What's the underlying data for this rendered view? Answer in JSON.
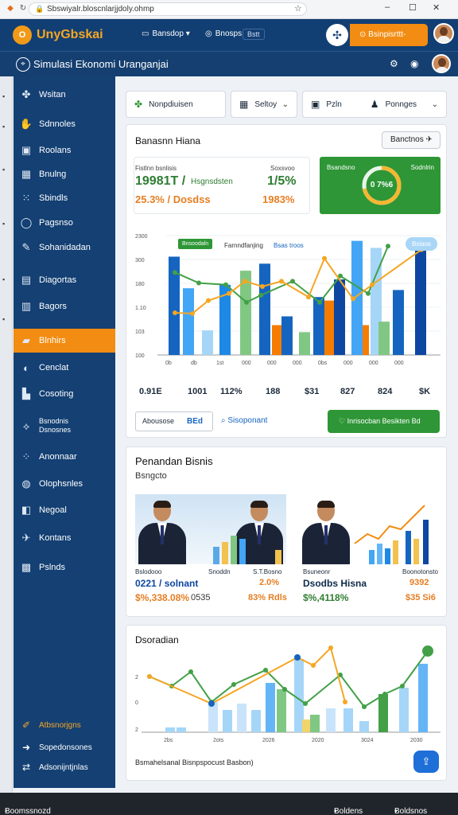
{
  "browser": {
    "address": "Sbswiyalr.bloscnlarjjdoly.ohmp",
    "window_controls": [
      "–",
      "☐",
      "✕"
    ]
  },
  "header": {
    "brand": "UnyGbskai",
    "brand_mark": "O",
    "nav": [
      {
        "icon": "display-icon",
        "label": "Bansdop"
      },
      {
        "icon": "globe-icon",
        "label": "Bnosps"
      }
    ],
    "ghost_label": "Bstt",
    "cta_label": "Bsinpisrttt-hasent",
    "colors": {
      "primary": "#123f73",
      "accent": "#f28c12",
      "success": "#2e9636"
    }
  },
  "subheader": {
    "title": "Simulasi Ekonomi Uranganjai",
    "title_icon": "compass-icon"
  },
  "sidebar": {
    "items": [
      {
        "icon": "puzzle-icon",
        "label": "Wsitan"
      },
      {
        "icon": "hand-icon",
        "label": "Sdnnoles"
      },
      {
        "icon": "monitor-icon",
        "label": "Roolans"
      },
      {
        "icon": "calendar-icon",
        "label": "Bnulng"
      },
      {
        "icon": "grid-icon",
        "label": "Sbindls"
      },
      {
        "icon": "chat-icon",
        "label": "Pagsnso"
      },
      {
        "icon": "wrench-icon",
        "label": "Sohanidadan"
      },
      {
        "icon": "book-icon",
        "label": "Diagortas"
      },
      {
        "icon": "bookmark-icon",
        "label": "Bagors"
      },
      {
        "icon": "folder-icon",
        "label": "Blnhirs",
        "active": true
      },
      {
        "icon": "shield-icon",
        "label": "Cenclat"
      },
      {
        "icon": "building-icon",
        "label": "Cosoting"
      },
      {
        "icon": "network-icon",
        "label": "Bsnodnis Dsnosnes"
      },
      {
        "icon": "dots-icon",
        "label": "Anonnaar"
      },
      {
        "icon": "globe-icon",
        "label": "Olophsnles"
      },
      {
        "icon": "map-icon",
        "label": "Negoal"
      },
      {
        "icon": "plane-icon",
        "label": "Kontans"
      },
      {
        "icon": "apps-icon",
        "label": "Pslnds"
      }
    ],
    "footer": [
      {
        "icon": "edit-icon",
        "label": "Atbsnorjgns",
        "accent": true
      },
      {
        "icon": "arrow-icon",
        "label": "Sopedonsones"
      },
      {
        "icon": "link-icon",
        "label": "Adsonijntjnlas"
      }
    ]
  },
  "filters": {
    "f1": {
      "icon": "puzzle-icon",
      "label": "Nonpdiuisen"
    },
    "f2": {
      "icon": "calendar-icon",
      "label": "Seltoy"
    },
    "f3": {
      "icon": "monitor-icon",
      "label": "Pzln"
    },
    "f4": {
      "icon": "person-icon",
      "label": "Ponnges"
    }
  },
  "main_card": {
    "title": "Banasnn Hiana",
    "action_label": "Banctnos",
    "action_icon": "plane-icon",
    "kpi": {
      "label_left": "Fistlnn bsnlisis",
      "label_right": "Soxsvoo",
      "big_left": "19981T /",
      "big_left_tail": "Hsgnsdsten",
      "big_right": "1/5%",
      "mid_left": "25.3% / Dosdss",
      "mid_right": "1983%"
    },
    "green": {
      "label_left": "Bsandsno",
      "label_right": "Sodnlrin",
      "gauge_text": "0 7%6",
      "gauge_value": 0.72
    },
    "legend_badge": "Bnsoodaln",
    "legend_texts": [
      "Farnndfanjing",
      "Bsas troos"
    ],
    "bubble": "Bsiaos",
    "chart_data": {
      "type": "bar",
      "ylabels": [
        "2300",
        "300",
        "180",
        "1.10",
        "103",
        "100"
      ],
      "xlabels": [
        "0b",
        "db",
        "1st",
        "000",
        "000",
        "000",
        "0bs",
        "000",
        "000",
        "000"
      ],
      "series": [
        {
          "color": "#1565c0",
          "values": [
            280,
            130,
            270,
            190,
            160,
            130,
            230
          ]
        },
        {
          "color": "#42a5f5",
          "values": [
            185,
            325,
            300
          ]
        },
        {
          "color": "#81c784",
          "values": [
            180,
            40,
            200
          ]
        },
        {
          "color": "#f57c00",
          "values": [
            55,
            55,
            55
          ]
        }
      ],
      "line_green": [
        235,
        205,
        200,
        150,
        170,
        210,
        150,
        225,
        175,
        310
      ],
      "line_orange": [
        120,
        118,
        155,
        175,
        210,
        195,
        210,
        165,
        275,
        160,
        200,
        300
      ]
    },
    "stats": [
      {
        "value": "0.91E",
        "color": "#0d47a1"
      },
      {
        "value": "1001",
        "color": "#0d47a1"
      },
      {
        "value": "112%",
        "color": "#f57c00"
      },
      {
        "value": "188",
        "color": "#0d47a1"
      },
      {
        "value": "$31",
        "color": "#2e7d32"
      },
      {
        "value": "827",
        "color": "#2e7d32"
      },
      {
        "value": "824",
        "color": "#2e7d32"
      },
      {
        "value": "$K",
        "color": "#0d47a1"
      }
    ],
    "input_label": "Abousose",
    "input_value": "BEd",
    "search_label": "Sisoponant",
    "green_button": "Inrisocban Besikten Bd"
  },
  "business_card": {
    "title": "Penandan Bisnis",
    "subtitle": "Bsngcto",
    "left": {
      "caption_left": "Bslodooo",
      "caption_mid": "Snoddn",
      "caption_right": "S.T.Bosno",
      "value_a": "0221 / solnant",
      "value_b": "2.0%",
      "value_c": "$%,338.08%",
      "value_d": "0535",
      "value_e": "83% Rdls"
    },
    "right": {
      "caption_left": "Bsuneonr",
      "caption_right": "Boonotonsto",
      "value_a": "Dsodbs Hisna",
      "value_b": "9392",
      "value_c": "$%,4118%",
      "value_d": "$35 Si6"
    }
  },
  "bottom_card": {
    "title": "Dsoradian",
    "footer_text": "Bsmahelsanal Bisnpspocust Basbon)",
    "xlabels": [
      "2bs",
      "2ots",
      "2026",
      "2020",
      "3024",
      "2030"
    ],
    "ylabels": [
      "2",
      "0",
      "2"
    ],
    "badge": "★"
  },
  "statusbar": {
    "left": "Boomssnozd",
    "center": "Boldens",
    "right": "Boldsnos"
  }
}
